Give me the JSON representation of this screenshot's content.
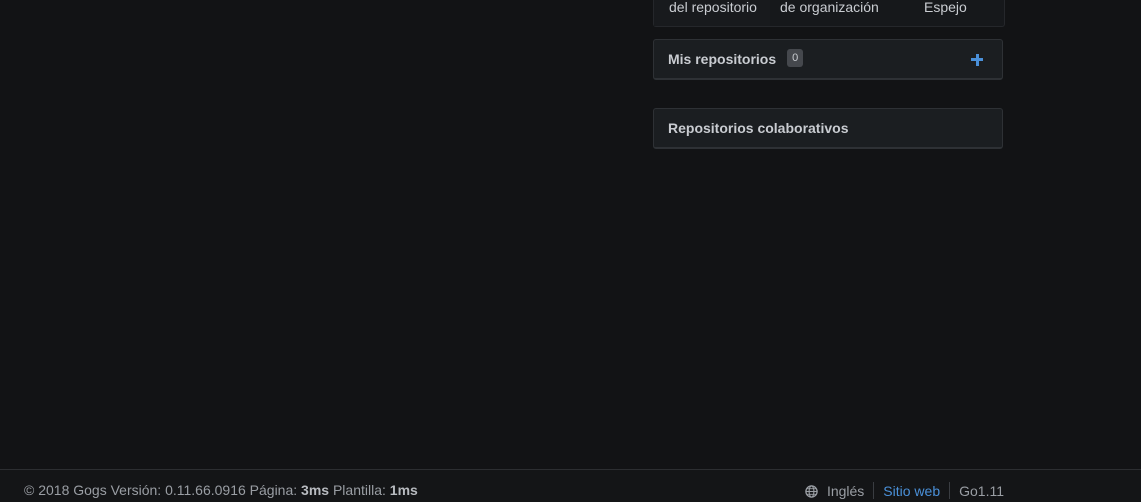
{
  "tabs": [
    {
      "label": "del repositorio"
    },
    {
      "label": "de organización"
    },
    {
      "label": "Espejo"
    }
  ],
  "my_repos": {
    "title": "Mis repositorios",
    "count": "0",
    "add_icon": "plus-icon"
  },
  "collab_repos": {
    "title": "Repositorios colaborativos"
  },
  "footer": {
    "copyright": "© 2018 Gogs Versión: 0.11.66.0916 Página:",
    "page_time": "3ms",
    "template_label": "Plantilla:",
    "template_time": "1ms",
    "language_icon": "globe-icon",
    "language": "Inglés",
    "website": "Sitio web",
    "go_version": "Go1.11"
  },
  "colors": {
    "background": "#121315",
    "accent": "#4a90d9",
    "panel": "#1b1e21"
  }
}
